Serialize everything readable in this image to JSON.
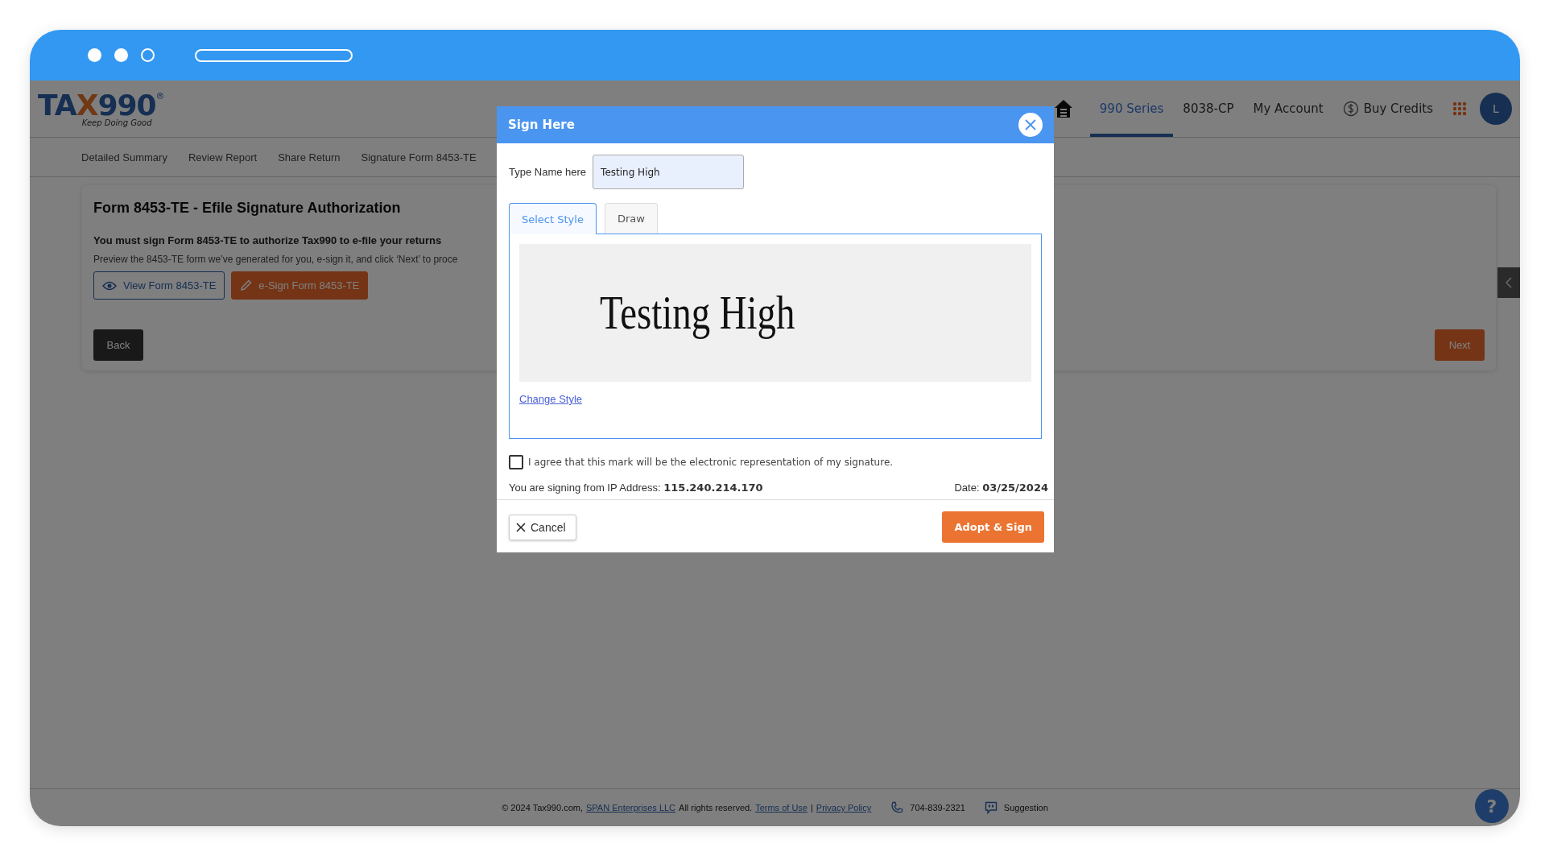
{
  "header": {
    "logo": "TAX990",
    "logo_mark": "®",
    "tagline": "Keep Doing Good",
    "nav": [
      {
        "label": "990 Series",
        "selected": true,
        "kind": "link"
      },
      {
        "label": "8038-CP",
        "selected": false,
        "kind": "link"
      },
      {
        "label": "My Account",
        "selected": false,
        "kind": "link"
      },
      {
        "label": "Buy Credits",
        "selected": false,
        "kind": "credits"
      }
    ],
    "avatar": "L"
  },
  "subnav": [
    "Detailed Summary",
    "Review Report",
    "Share Return",
    "Signature Form 8453-TE"
  ],
  "card": {
    "title": "Form 8453-TE - Efile Signature Authorization",
    "lead": "You must sign Form 8453-TE to authorize Tax990 to e-file your returns",
    "note": "Preview the 8453-TE form we’ve generated for you, e-sign it, and click ‘Next’ to proce",
    "buttons": [
      {
        "label": "View Form 8453-TE",
        "kind": "view"
      },
      {
        "label": "e-Sign Form 8453-TE",
        "kind": "esign"
      }
    ],
    "back": "Back",
    "next": "Next"
  },
  "modal": {
    "title": "Sign Here",
    "name_label": "Type Name here",
    "name_value": "Testing High",
    "tabs": [
      {
        "label": "Select Style",
        "selected": true
      },
      {
        "label": "Draw",
        "selected": false
      }
    ],
    "signature": "Testing High",
    "change_style": "Change Style",
    "agree": {
      "label": "I agree that this mark will be the electronic representation of my signature.",
      "checked": false
    },
    "ip_label": "You are signing from IP Address:",
    "ip": "115.240.214.170",
    "date_label": "Date:",
    "date": "03/25/2024",
    "cancel": "Cancel",
    "adopt": "Adopt & Sign"
  },
  "footer": {
    "copyright": "© 2024 Tax990.com,",
    "company": "SPAN Enterprises LLC",
    "rights": "All rights reserved.",
    "terms": "Terms of Use",
    "separator": "|",
    "privacy": "Privacy Policy",
    "phone": "704-839-2321",
    "suggestion": "Suggestion"
  },
  "help": "?"
}
